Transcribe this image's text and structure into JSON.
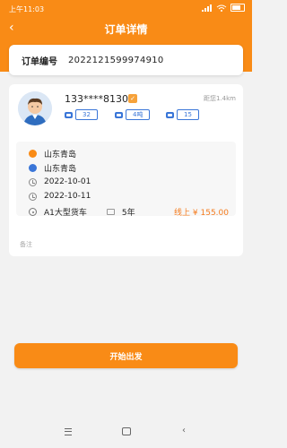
{
  "status_bar": {
    "time": "上午11:03"
  },
  "header": {
    "title": "订单详情"
  },
  "order": {
    "label": "订单编号",
    "number": "2022121599974910"
  },
  "driver": {
    "phone": "133****8130",
    "distance": "距您1.4km",
    "stats": [
      "32",
      "4吨",
      "15"
    ]
  },
  "route": {
    "start": "山东青岛",
    "end": "山东青岛",
    "date_start": "2022-10-01",
    "date_end": "2022-10-11",
    "license": "A1大型货车",
    "years": "5年",
    "price": "线上 ¥ 155.00"
  },
  "remark_placeholder": "备注",
  "start_button": "开始出发",
  "colors": {
    "primary": "#f98b16",
    "blue": "#3a76d8",
    "price": "#f57c1f"
  }
}
